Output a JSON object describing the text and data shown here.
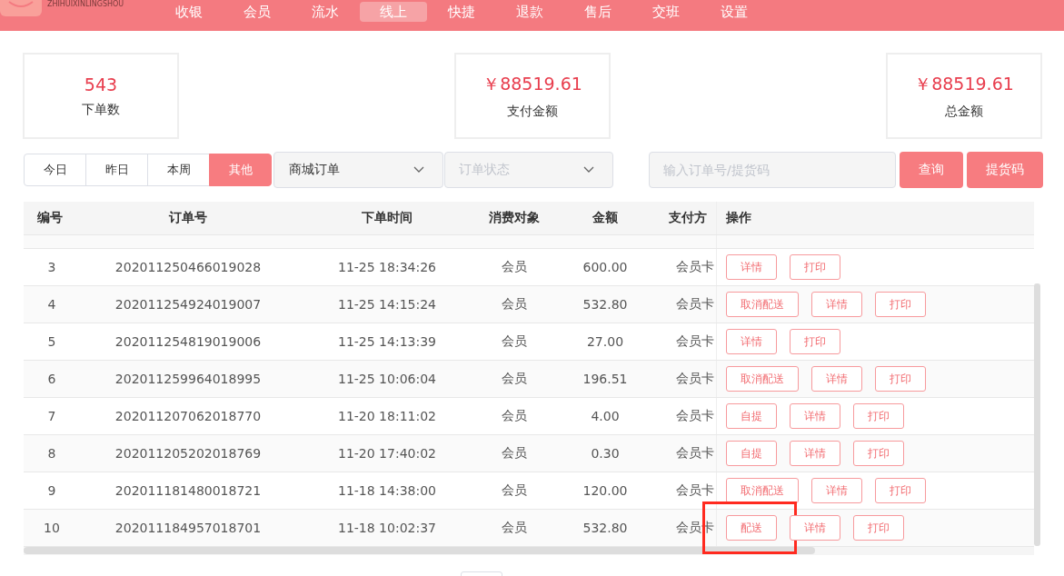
{
  "header": {
    "logo_text": "ZHIHUIXINLINGSHOU",
    "nav": [
      {
        "label": "收银",
        "selected": false
      },
      {
        "label": "会员",
        "selected": false
      },
      {
        "label": "流水",
        "selected": false
      },
      {
        "label": "线上",
        "selected": true
      },
      {
        "label": "快捷",
        "selected": false
      },
      {
        "label": "退款",
        "selected": false
      },
      {
        "label": "售后",
        "selected": false
      },
      {
        "label": "交班",
        "selected": false
      },
      {
        "label": "设置",
        "selected": false
      }
    ]
  },
  "stats": [
    {
      "value": "543",
      "label": "下单数"
    },
    {
      "value": "￥88519.61",
      "label": "支付金额"
    },
    {
      "value": "￥88519.61",
      "label": "总金额"
    }
  ],
  "filters": {
    "periods": [
      {
        "label": "今日",
        "selected": false
      },
      {
        "label": "昨日",
        "selected": false
      },
      {
        "label": "本周",
        "selected": false
      },
      {
        "label": "其他",
        "selected": true
      }
    ],
    "order_type": {
      "value": "商城订单"
    },
    "order_status": {
      "placeholder": "订单状态"
    },
    "search": {
      "placeholder": "输入订单号/提货码"
    },
    "buttons": [
      "查询",
      "提货码"
    ]
  },
  "table": {
    "columns": [
      "编号",
      "订单号",
      "下单时间",
      "消费对象",
      "金额",
      "支付方"
    ],
    "actions_column": "操作",
    "rows": [
      {
        "no": "3",
        "order_no": "202011250466019028",
        "time": "11-25 18:34:26",
        "target": "会员",
        "amount": "600.00",
        "payment": "会员卡",
        "actions": [
          {
            "kind": "short",
            "label": "详情",
            "highlight": false
          },
          {
            "kind": "short",
            "label": "打印",
            "highlight": false
          }
        ]
      },
      {
        "no": "4",
        "order_no": "202011254924019007",
        "time": "11-25 14:15:24",
        "target": "会员",
        "amount": "532.80",
        "payment": "会员卡",
        "actions": [
          {
            "kind": "wide",
            "label": "取消配送",
            "highlight": false
          },
          {
            "kind": "short",
            "label": "详情",
            "highlight": false
          },
          {
            "kind": "short",
            "label": "打印",
            "highlight": false
          }
        ]
      },
      {
        "no": "5",
        "order_no": "202011254819019006",
        "time": "11-25 14:13:39",
        "target": "会员",
        "amount": "27.00",
        "payment": "会员卡",
        "actions": [
          {
            "kind": "short",
            "label": "详情",
            "highlight": false
          },
          {
            "kind": "short",
            "label": "打印",
            "highlight": false
          }
        ]
      },
      {
        "no": "6",
        "order_no": "202011259964018995",
        "time": "11-25 10:06:04",
        "target": "会员",
        "amount": "196.51",
        "payment": "会员卡",
        "actions": [
          {
            "kind": "wide",
            "label": "取消配送",
            "highlight": false
          },
          {
            "kind": "short",
            "label": "详情",
            "highlight": false
          },
          {
            "kind": "short",
            "label": "打印",
            "highlight": false
          }
        ]
      },
      {
        "no": "7",
        "order_no": "202011207062018770",
        "time": "11-20 18:11:02",
        "target": "会员",
        "amount": "4.00",
        "payment": "会员卡",
        "actions": [
          {
            "kind": "short",
            "label": "自提",
            "highlight": false
          },
          {
            "kind": "short",
            "label": "详情",
            "highlight": false
          },
          {
            "kind": "short",
            "label": "打印",
            "highlight": false
          }
        ]
      },
      {
        "no": "8",
        "order_no": "202011205202018769",
        "time": "11-20 17:40:02",
        "target": "会员",
        "amount": "0.30",
        "payment": "会员卡",
        "actions": [
          {
            "kind": "short",
            "label": "自提",
            "highlight": false
          },
          {
            "kind": "short",
            "label": "详情",
            "highlight": false
          },
          {
            "kind": "short",
            "label": "打印",
            "highlight": false
          }
        ]
      },
      {
        "no": "9",
        "order_no": "202011181480018721",
        "time": "11-18 14:38:00",
        "target": "会员",
        "amount": "120.00",
        "payment": "会员卡",
        "actions": [
          {
            "kind": "wide",
            "label": "取消配送",
            "highlight": false
          },
          {
            "kind": "short",
            "label": "详情",
            "highlight": false
          },
          {
            "kind": "short",
            "label": "打印",
            "highlight": false
          }
        ]
      },
      {
        "no": "10",
        "order_no": "202011184957018701",
        "time": "11-18 10:02:37",
        "target": "会员",
        "amount": "532.80",
        "payment": "会员卡",
        "actions": [
          {
            "kind": "short",
            "label": "配送",
            "highlight": true
          },
          {
            "kind": "short",
            "label": "详情",
            "highlight": false
          },
          {
            "kind": "short",
            "label": "打印",
            "highlight": false
          }
        ]
      }
    ]
  }
}
